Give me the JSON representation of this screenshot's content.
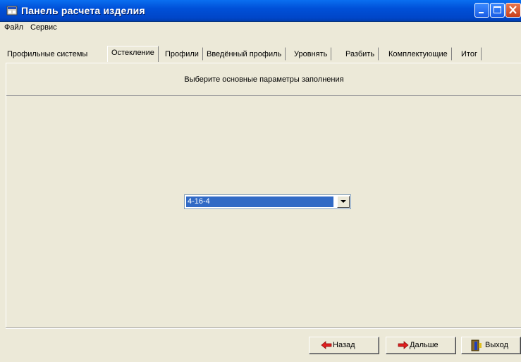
{
  "window": {
    "title": "Панель расчета изделия"
  },
  "menu": [
    "Файл",
    "Сервис"
  ],
  "tabs": [
    {
      "label": "Профильные системы"
    },
    {
      "label": "Остекление",
      "active": true
    },
    {
      "label": "Профили"
    },
    {
      "label": "Введённый профиль"
    },
    {
      "label": "Уровнять"
    },
    {
      "label": "Разбить"
    },
    {
      "label": "Комплектующие"
    },
    {
      "label": "Итог"
    }
  ],
  "panel": {
    "header": "Выберите основные параметры заполнения"
  },
  "glazing_select": {
    "value": "4-16-4"
  },
  "buttons": {
    "back": "Назад",
    "next": "Дальше",
    "exit": "Выход"
  },
  "colors": {
    "titlebar": "#0050d8",
    "selection": "#316ac5",
    "face": "#ece9d8"
  }
}
